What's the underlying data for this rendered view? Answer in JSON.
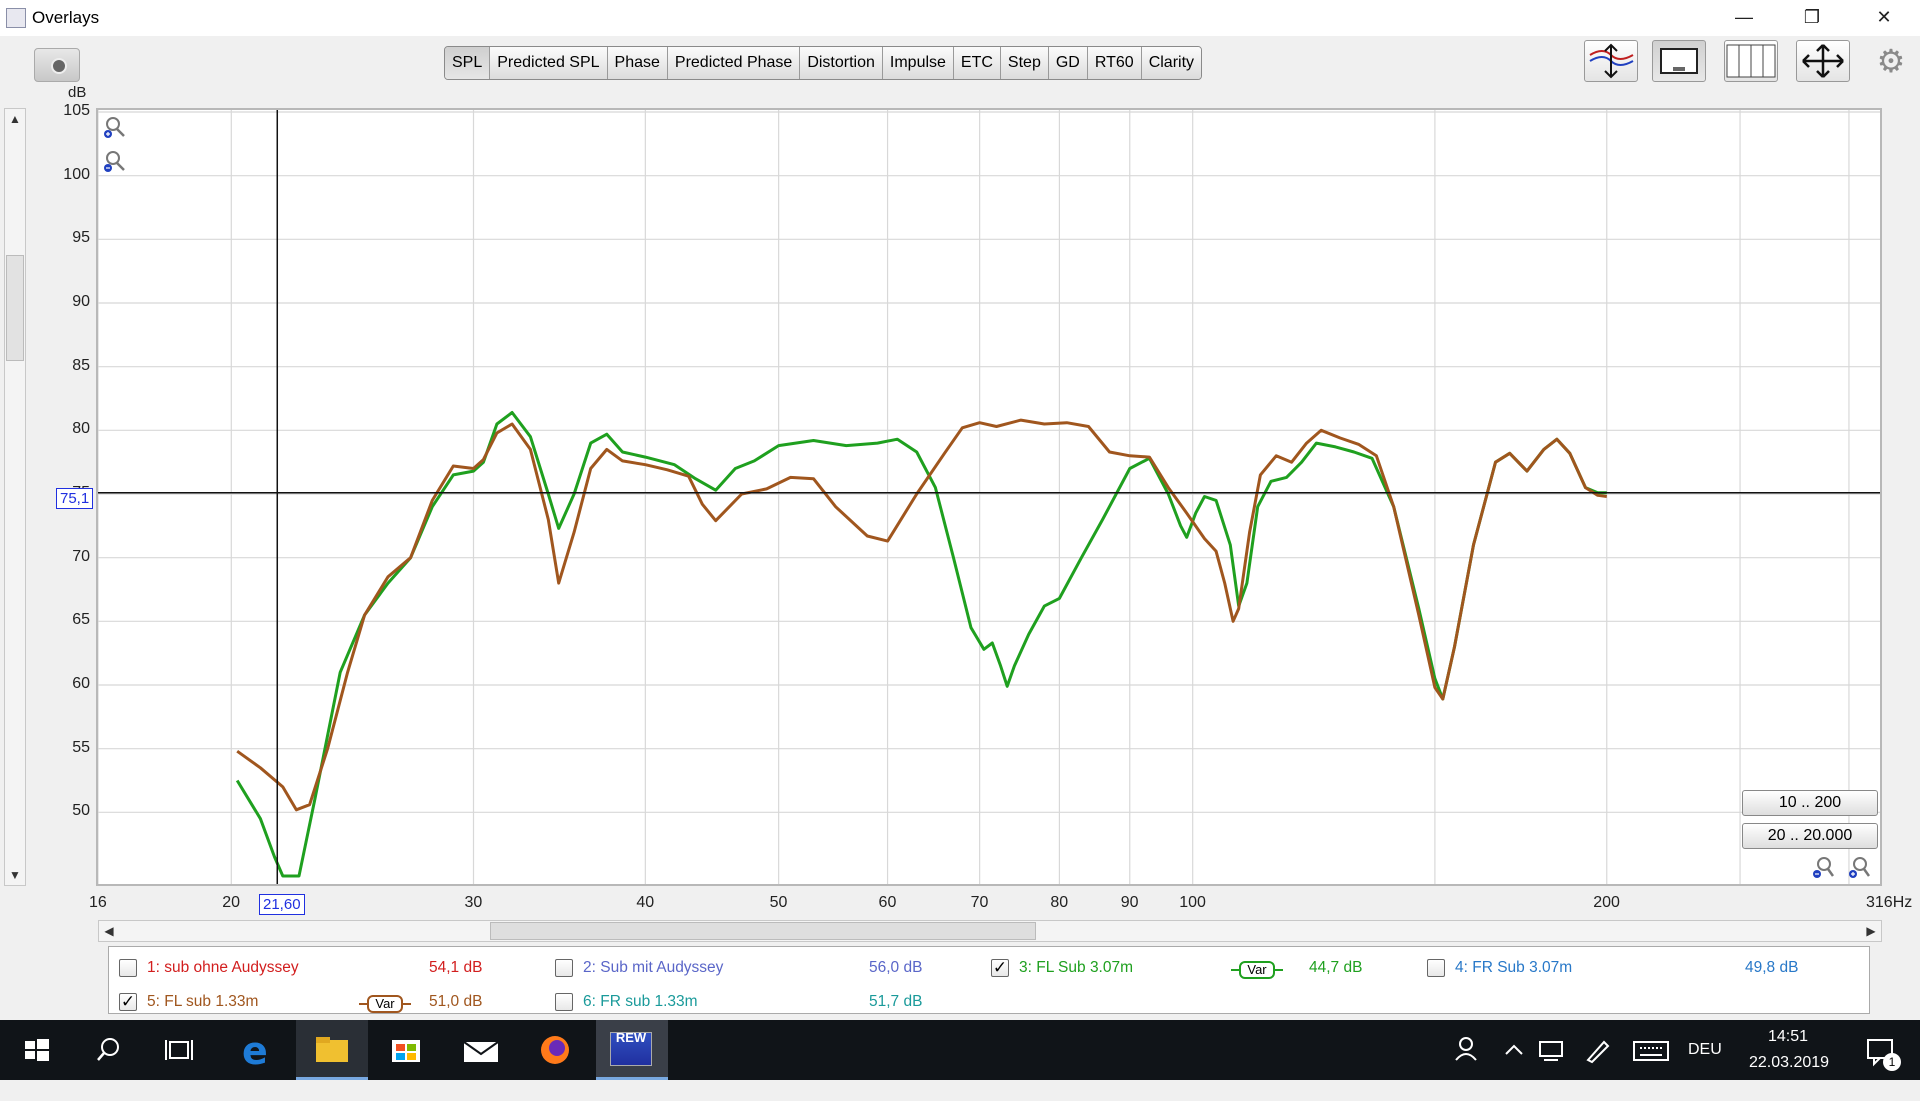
{
  "window": {
    "title": "Overlays",
    "minimize": "—",
    "restore": "❐",
    "close": "✕"
  },
  "tabs": [
    "SPL",
    "Predicted SPL",
    "Phase",
    "Predicted Phase",
    "Distortion",
    "Impulse",
    "ETC",
    "Step",
    "GD",
    "RT60",
    "Clarity"
  ],
  "active_tab": "SPL",
  "toolbar_icons": [
    "overlay-traces-icon",
    "window-layout-icon",
    "columns-icon",
    "arrows-move-icon",
    "gear-icon"
  ],
  "graph": {
    "y_unit": "dB",
    "x_unit": "Hz",
    "cursor_x_label": "21,60",
    "cursor_y_label": "75,1",
    "range_buttons": [
      "10 .. 200",
      "20 .. 20.000"
    ]
  },
  "chart_data": {
    "type": "line",
    "ylabel": "dB",
    "xlabel": "Hz",
    "x_scale": "log",
    "xlim": [
      16,
      316
    ],
    "ylim": [
      45,
      105
    ],
    "x_ticks": [
      16,
      20,
      30,
      40,
      50,
      60,
      70,
      80,
      90,
      100,
      200
    ],
    "x_tick_labels": [
      "16",
      "20",
      "30",
      "40",
      "50",
      "60",
      "70",
      "80",
      "90",
      "100",
      "200",
      "316Hz"
    ],
    "y_ticks": [
      50,
      55,
      60,
      65,
      70,
      75,
      80,
      85,
      90,
      95,
      100,
      105
    ],
    "grid": true,
    "cursor": {
      "x": 21.6,
      "y": 75.1
    },
    "series": [
      {
        "name": "3: FL Sub 3.07m",
        "color": "#1fa01f",
        "points": [
          [
            20.2,
            52.5
          ],
          [
            21.0,
            49.5
          ],
          [
            21.5,
            46.5
          ],
          [
            21.8,
            45.0
          ],
          [
            22.4,
            45.0
          ],
          [
            23.0,
            51
          ],
          [
            24.0,
            61
          ],
          [
            25.0,
            65.5
          ],
          [
            26.0,
            68
          ],
          [
            27.0,
            70
          ],
          [
            28.0,
            74
          ],
          [
            29.0,
            76.5
          ],
          [
            30.0,
            76.8
          ],
          [
            30.5,
            77.5
          ],
          [
            31.2,
            80.5
          ],
          [
            32.0,
            81.4
          ],
          [
            33.0,
            79.5
          ],
          [
            34.0,
            75
          ],
          [
            34.6,
            72.3
          ],
          [
            35.5,
            75
          ],
          [
            36.5,
            79
          ],
          [
            37.5,
            79.7
          ],
          [
            38.5,
            78.3
          ],
          [
            40.0,
            77.9
          ],
          [
            42.0,
            77.3
          ],
          [
            43.5,
            76.2
          ],
          [
            45.0,
            75.3
          ],
          [
            46.5,
            77
          ],
          [
            48.0,
            77.6
          ],
          [
            50.0,
            78.8
          ],
          [
            53.0,
            79.2
          ],
          [
            56.0,
            78.8
          ],
          [
            59.0,
            79.0
          ],
          [
            61.0,
            79.3
          ],
          [
            63.0,
            78.3
          ],
          [
            65.0,
            75.5
          ],
          [
            67.0,
            70
          ],
          [
            69.0,
            64.5
          ],
          [
            70.5,
            62.8
          ],
          [
            71.5,
            63.3
          ],
          [
            72.5,
            61.5
          ],
          [
            73.3,
            59.9
          ],
          [
            74.2,
            61.5
          ],
          [
            76.0,
            64
          ],
          [
            78.0,
            66.2
          ],
          [
            80.0,
            66.8
          ],
          [
            83.0,
            70
          ],
          [
            86.0,
            73
          ],
          [
            90.0,
            77
          ],
          [
            93.0,
            77.8
          ],
          [
            96.0,
            75
          ],
          [
            98.0,
            72.5
          ],
          [
            99.0,
            71.6
          ],
          [
            100.5,
            73.5
          ],
          [
            102.0,
            74.8
          ],
          [
            104.0,
            74.5
          ],
          [
            106.5,
            71
          ],
          [
            108.0,
            66.2
          ],
          [
            109.5,
            68
          ],
          [
            111.5,
            74
          ],
          [
            114.0,
            76
          ],
          [
            117.0,
            76.3
          ],
          [
            120.0,
            77.5
          ],
          [
            123.0,
            79
          ],
          [
            127.0,
            78.7
          ],
          [
            131.0,
            78.3
          ],
          [
            135.0,
            77.8
          ],
          [
            140.0,
            74
          ],
          [
            146.0,
            66
          ],
          [
            150.0,
            60.5
          ],
          [
            152.0,
            58.9
          ],
          [
            155.0,
            63
          ],
          [
            160.0,
            71
          ],
          [
            166.0,
            77.5
          ],
          [
            170.0,
            78.2
          ],
          [
            175.0,
            76.8
          ],
          [
            180.0,
            78.5
          ],
          [
            184.0,
            79.3
          ],
          [
            188.0,
            78.2
          ],
          [
            193.0,
            75.5
          ],
          [
            197.0,
            75.1
          ],
          [
            200.0,
            75.1
          ]
        ]
      },
      {
        "name": "5: FL sub 1.33m",
        "color": "#a0561e",
        "points": [
          [
            20.2,
            54.8
          ],
          [
            21.0,
            53.5
          ],
          [
            21.8,
            52
          ],
          [
            22.3,
            50.2
          ],
          [
            22.8,
            50.6
          ],
          [
            23.5,
            55
          ],
          [
            24.3,
            61
          ],
          [
            25.0,
            65.5
          ],
          [
            26.0,
            68.5
          ],
          [
            27.0,
            70
          ],
          [
            28.0,
            74.5
          ],
          [
            29.0,
            77.2
          ],
          [
            30.0,
            77
          ],
          [
            30.5,
            77.7
          ],
          [
            31.2,
            79.8
          ],
          [
            32.0,
            80.5
          ],
          [
            33.0,
            78.5
          ],
          [
            34.0,
            73
          ],
          [
            34.6,
            68
          ],
          [
            35.5,
            72
          ],
          [
            36.5,
            77
          ],
          [
            37.5,
            78.5
          ],
          [
            38.5,
            77.6
          ],
          [
            40.0,
            77.3
          ],
          [
            41.5,
            76.9
          ],
          [
            43.0,
            76.4
          ],
          [
            44.0,
            74.2
          ],
          [
            45.0,
            72.9
          ],
          [
            47.0,
            75
          ],
          [
            49.0,
            75.4
          ],
          [
            51.0,
            76.3
          ],
          [
            53.0,
            76.2
          ],
          [
            55.0,
            74
          ],
          [
            58.0,
            71.7
          ],
          [
            60.0,
            71.3
          ],
          [
            63.0,
            75
          ],
          [
            66.0,
            78.2
          ],
          [
            68.0,
            80.2
          ],
          [
            70.0,
            80.6
          ],
          [
            72.0,
            80.3
          ],
          [
            75.0,
            80.8
          ],
          [
            78.0,
            80.5
          ],
          [
            81.0,
            80.6
          ],
          [
            84.0,
            80.3
          ],
          [
            87.0,
            78.3
          ],
          [
            90.0,
            78.0
          ],
          [
            93.0,
            77.9
          ],
          [
            96.0,
            75.5
          ],
          [
            99.0,
            73.5
          ],
          [
            102.0,
            71.5
          ],
          [
            104.0,
            70.5
          ],
          [
            105.5,
            68
          ],
          [
            107.0,
            65
          ],
          [
            108.0,
            66
          ],
          [
            110.0,
            72
          ],
          [
            112.0,
            76.5
          ],
          [
            115.0,
            78
          ],
          [
            118.0,
            77.5
          ],
          [
            121.0,
            79
          ],
          [
            124.0,
            80
          ],
          [
            128.0,
            79.4
          ],
          [
            132.0,
            78.9
          ],
          [
            136.0,
            78
          ],
          [
            140.0,
            74
          ],
          [
            146.0,
            65.5
          ],
          [
            150.0,
            59.8
          ],
          [
            152.0,
            58.9
          ],
          [
            155.0,
            63
          ],
          [
            160.0,
            71
          ],
          [
            166.0,
            77.5
          ],
          [
            170.0,
            78.2
          ],
          [
            175.0,
            76.8
          ],
          [
            180.0,
            78.5
          ],
          [
            184.0,
            79.3
          ],
          [
            188.0,
            78.2
          ],
          [
            193.0,
            75.5
          ],
          [
            197.0,
            74.9
          ],
          [
            200.0,
            74.8
          ]
        ]
      }
    ]
  },
  "legend": [
    {
      "label": "1: sub ohne Audyssey",
      "value": "54,1 dB",
      "color": "#d21e1e",
      "checked": ""
    },
    {
      "label": "2: Sub mit Audyssey",
      "value": "56,0 dB",
      "color": "#5a66c8",
      "checked": ""
    },
    {
      "label": "3: FL Sub 3.07m",
      "value": "44,7 dB",
      "color": "#1fa01f",
      "checked": "✓",
      "var": "Var"
    },
    {
      "label": "4: FR Sub 3.07m",
      "value": "49,8 dB",
      "color": "#2878c8",
      "checked": ""
    },
    {
      "label": "5: FL sub 1.33m",
      "value": "51,0 dB",
      "color": "#a0561e",
      "checked": "✓",
      "var": "Var"
    },
    {
      "label": "6: FR sub 1.33m",
      "value": "51,7 dB",
      "color": "#1a9a9a",
      "checked": ""
    }
  ],
  "taskbar": {
    "icons": [
      "windows-start-icon",
      "search-icon",
      "task-view-icon",
      "edge-icon",
      "file-explorer-icon",
      "store-icon",
      "mail-icon",
      "firefox-icon",
      "rew-icon"
    ],
    "rew_label": "REW",
    "lang": "DEU",
    "time": "14:51",
    "date": "22.03.2019",
    "notifications": "1"
  }
}
